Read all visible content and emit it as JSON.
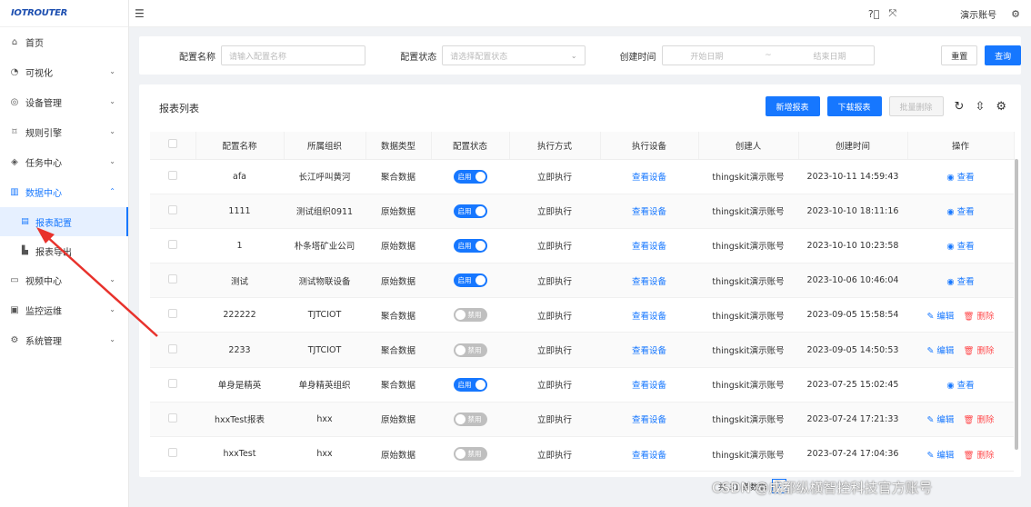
{
  "logo": "IOTROUTER",
  "header": {
    "account": "演示账号"
  },
  "sidebar": {
    "items": [
      {
        "label": "首页",
        "icon": "home-icon"
      },
      {
        "label": "可视化",
        "icon": "dashboard-icon"
      },
      {
        "label": "设备管理",
        "icon": "device-icon"
      },
      {
        "label": "规则引擎",
        "icon": "rule-icon"
      },
      {
        "label": "任务中心",
        "icon": "task-icon"
      },
      {
        "label": "数据中心",
        "icon": "chart-icon"
      },
      {
        "label": "视频中心",
        "icon": "video-icon"
      },
      {
        "label": "监控运维",
        "icon": "monitor-icon"
      },
      {
        "label": "系统管理",
        "icon": "settings-icon"
      }
    ],
    "sub_items": [
      {
        "label": "报表配置"
      },
      {
        "label": "报表导出"
      }
    ]
  },
  "filter": {
    "name_label": "配置名称",
    "name_placeholder": "请输入配置名称",
    "status_label": "配置状态",
    "status_placeholder": "请选择配置状态",
    "time_label": "创建时间",
    "start_placeholder": "开始日期",
    "separator": "~",
    "end_placeholder": "结束日期",
    "reset": "重置",
    "query": "查询"
  },
  "list": {
    "title": "报表列表",
    "add": "新增报表",
    "download": "下载报表",
    "batch_delete": "批量删除"
  },
  "table": {
    "headers": [
      "配置名称",
      "所属组织",
      "数据类型",
      "配置状态",
      "执行方式",
      "执行设备",
      "创建人",
      "创建时间",
      "操作"
    ],
    "rows": [
      {
        "name": "afa",
        "org": "长江呼叫黄河",
        "type": "聚合数据",
        "status": "启用",
        "mode": "立即执行",
        "device": "查看设备",
        "creator": "thingskit演示账号",
        "time": "2023-10-11 14:59:43",
        "actions": [
          "查看"
        ]
      },
      {
        "name": "1111",
        "org": "测试组织0911",
        "type": "原始数据",
        "status": "启用",
        "mode": "立即执行",
        "device": "查看设备",
        "creator": "thingskit演示账号",
        "time": "2023-10-10 18:11:16",
        "actions": [
          "查看"
        ]
      },
      {
        "name": "1",
        "org": "朴条塔矿业公司",
        "type": "原始数据",
        "status": "启用",
        "mode": "立即执行",
        "device": "查看设备",
        "creator": "thingskit演示账号",
        "time": "2023-10-10 10:23:58",
        "actions": [
          "查看"
        ]
      },
      {
        "name": "测试",
        "org": "测试物联设备",
        "type": "原始数据",
        "status": "启用",
        "mode": "立即执行",
        "device": "查看设备",
        "creator": "thingskit演示账号",
        "time": "2023-10-06 10:46:04",
        "actions": [
          "查看"
        ]
      },
      {
        "name": "222222",
        "org": "TJTCIOT",
        "type": "聚合数据",
        "status": "禁用",
        "mode": "立即执行",
        "device": "查看设备",
        "creator": "thingskit演示账号",
        "time": "2023-09-05 15:58:54",
        "actions": [
          "编辑",
          "删除"
        ]
      },
      {
        "name": "2233",
        "org": "TJTCIOT",
        "type": "聚合数据",
        "status": "禁用",
        "mode": "立即执行",
        "device": "查看设备",
        "creator": "thingskit演示账号",
        "time": "2023-09-05 14:50:53",
        "actions": [
          "编辑",
          "删除"
        ]
      },
      {
        "name": "单身是精英",
        "org": "单身精英组织",
        "type": "聚合数据",
        "status": "启用",
        "mode": "立即执行",
        "device": "查看设备",
        "creator": "thingskit演示账号",
        "time": "2023-07-25 15:02:45",
        "actions": [
          "查看"
        ]
      },
      {
        "name": "hxxTest报表",
        "org": "hxx",
        "type": "原始数据",
        "status": "禁用",
        "mode": "立即执行",
        "device": "查看设备",
        "creator": "thingskit演示账号",
        "time": "2023-07-24 17:21:33",
        "actions": [
          "编辑",
          "删除"
        ]
      },
      {
        "name": "hxxTest",
        "org": "hxx",
        "type": "原始数据",
        "status": "禁用",
        "mode": "立即执行",
        "device": "查看设备",
        "creator": "thingskit演示账号",
        "time": "2023-07-24 17:04:36",
        "actions": [
          "编辑",
          "删除"
        ]
      }
    ]
  },
  "pager": {
    "total": "共 31 条数据",
    "current": "1"
  },
  "watermark": "CSDN @成都纵横智控科技官方账号",
  "colors": {
    "primary": "#1677ff",
    "danger": "#ff4d4f",
    "arrow": "#e8322c"
  }
}
